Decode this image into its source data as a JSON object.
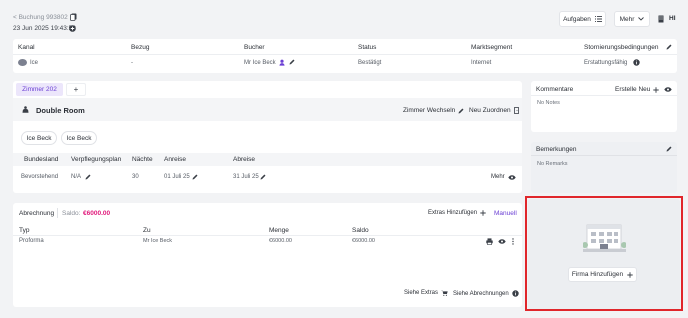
{
  "top": {
    "back_link": "< Buchung 993802",
    "datetime": "23 Jun 2025 19:43:59",
    "aufgaben": "Aufgaben",
    "mehr": "Mehr",
    "user_initials": "HI"
  },
  "summary": {
    "headers": [
      "Kanal",
      "Bezug",
      "Bucher",
      "Status",
      "Marktsegment",
      "Stornierungsbedingungen"
    ],
    "values": [
      "Ice",
      "-",
      "Mr Ice Beck",
      "Bestätigt",
      "Internet",
      "Erstattungsfähig"
    ]
  },
  "room": {
    "tab_label": "Zimmer 202",
    "add_tab": "+",
    "room_type": "Double Room",
    "change_room": "Zimmer Wechseln",
    "reassign": "Neu Zuordnen",
    "guests": [
      "Ice Beck",
      "Ice Beck"
    ],
    "table_headers": [
      "Bundesland",
      "Verpflegungsplan",
      "Nächte",
      "Anreise",
      "Abreise"
    ],
    "table_values": [
      "Bevorstehend",
      "N/A",
      "30",
      "01 Juli 25",
      "31 Juli 25"
    ],
    "more": "Mehr"
  },
  "billing": {
    "title": "Abrechnung",
    "saldo_label": "Saldo:",
    "saldo_value": "€6000.00",
    "add_extras": "Extras Hinzufügen",
    "manual": "Manuell",
    "headers": [
      "Typ",
      "Zu",
      "Menge",
      "Saldo"
    ],
    "row": [
      "Proforma",
      "Mr Ice Beck",
      "€6000.00",
      "€6000.00"
    ],
    "see_extras": "Siehe Extras",
    "see_bills": "Siehe Abrechnungen"
  },
  "comments": {
    "title": "Kommentare",
    "create_new": "Erstelle Neu",
    "empty": "No Notes"
  },
  "remarks": {
    "title": "Bemerkungen",
    "empty": "No Remarks"
  },
  "company": {
    "add_button": "Firma Hinzufügen"
  },
  "colors": {
    "accent_purple": "#6b3fd4",
    "saldo_pink": "#e0187a",
    "highlight_red": "#e0262b",
    "tab_bg": "#ece6fb"
  }
}
